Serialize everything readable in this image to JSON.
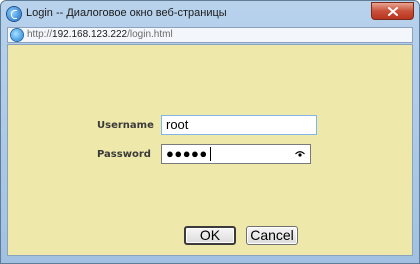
{
  "window": {
    "title": "Login -- Диалоговое окно веб-страницы",
    "close_icon": "close-x-icon"
  },
  "address": {
    "prefix": "http://",
    "host": "192.168.123.222",
    "path": "/login.html"
  },
  "form": {
    "username_label": "Username",
    "username_value": "root",
    "password_label": "Password",
    "password_masked": "●●●●●",
    "reveal_icon": "eye-icon"
  },
  "buttons": {
    "ok_label": "OK",
    "cancel_label": "Cancel"
  },
  "colors": {
    "content_background": "#eee8aa",
    "close_button": "#c9503a",
    "frame": "#a2c1e2"
  }
}
